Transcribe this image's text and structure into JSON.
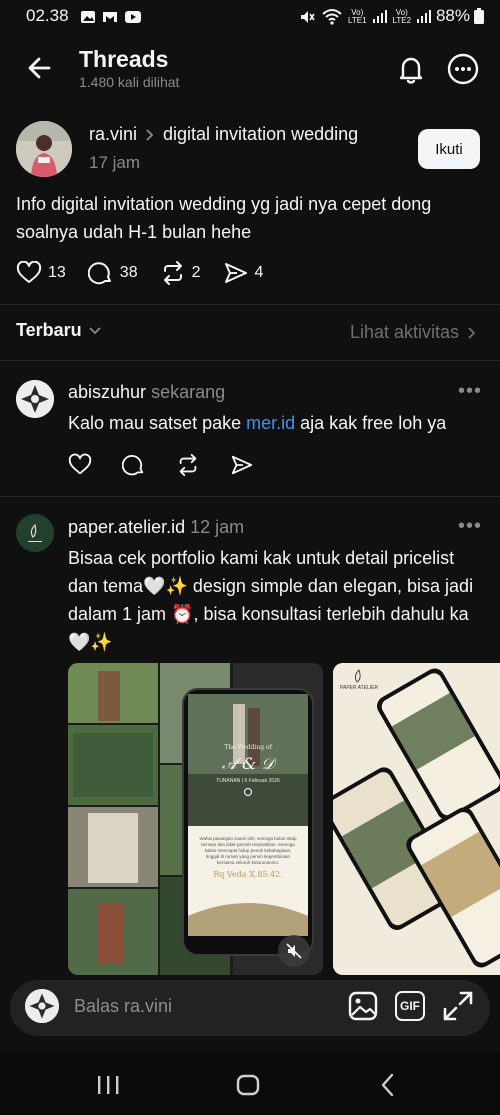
{
  "status_bar": {
    "time": "02.38",
    "battery": "88%",
    "sim1": "LTE1",
    "sim2": "LTE2"
  },
  "header": {
    "title": "Threads",
    "subtitle": "1.480 kali dilihat"
  },
  "post": {
    "author": "ra.vini",
    "topic": "digital invitation wedding",
    "time": "17 jam",
    "follow_label": "Ikuti",
    "text": "Info digital invitation wedding yg jadi nya cepet dong soalnya udah H-1 bulan hehe",
    "likes": "13",
    "replies": "38",
    "reposts": "2",
    "shares": "4"
  },
  "sort": {
    "label": "Terbaru",
    "activity": "Lihat aktivitas"
  },
  "replies": [
    {
      "author": "abiszuhur",
      "time": "sekarang",
      "text_before": "Kalo mau satset pake ",
      "link": "mer.id",
      "text_after": " aja kak free loh ya"
    },
    {
      "author": "paper.atelier.id",
      "time": "12 jam",
      "text": "Bisaa cek portfolio kami kak untuk detail pricelist dan tema🤍✨ design simple dan elegan, bisa jadi dalam 1 jam ⏰, bisa konsultasi terlebih dahulu ka 🤍✨"
    }
  ],
  "media": {
    "phone_heading": "The Wedding of",
    "phone_date": "TUNANAN | 6 Februari 2026",
    "phone_body": "Wahai pasangan suami istri, semoga bulan tetap bersatu dan tidak pernah terpisahkan. Semoga kalian mencapai hidup penuh kebahagiaan, tinggal di rumah yang penuh kegembiraan bersama seluruh keturunanmu.",
    "phone_verse": "Rq Veda X.85.42.",
    "brand_logo_text": "PAPER ATELIER"
  },
  "reply_bar": {
    "placeholder": "Balas ra.vini",
    "gif_label": "GIF"
  },
  "icons": {
    "back": "arrow-left-icon",
    "bell": "bell-icon",
    "more": "more-icon",
    "like": "heart-icon",
    "comment": "comment-icon",
    "repost": "repost-icon",
    "share": "send-icon",
    "image": "image-icon",
    "gif": "gif-icon",
    "expand": "expand-icon",
    "mute": "mute-icon"
  },
  "colors": {
    "background": "#101010",
    "link": "#3d92f0",
    "muted": "#8a8a8a"
  }
}
